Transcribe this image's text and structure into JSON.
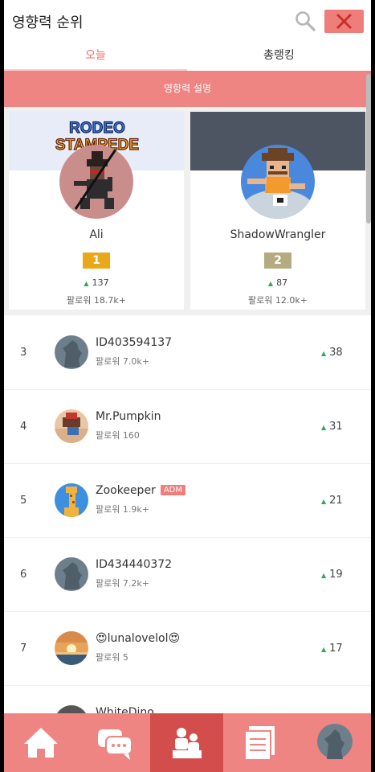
{
  "header": {
    "title": "영향력 순위"
  },
  "tabs": [
    {
      "label": "오늘",
      "active": true
    },
    {
      "label": "총랭킹",
      "active": false
    }
  ],
  "explain_label": "영향력 설명",
  "colors": {
    "accent": "#ef8583",
    "up": "#2fa84f",
    "gold": "#e8a81a",
    "silver": "#b4ab80"
  },
  "top": [
    {
      "rank": "1",
      "name": "Ali",
      "score": "137",
      "followers": "팔로워 18.7k+",
      "logo_text": "RODEO STAMPEDE"
    },
    {
      "rank": "2",
      "name": "ShadowWrangler",
      "score": "87",
      "followers": "팔로워 12.0k+"
    }
  ],
  "list": [
    {
      "rank": "3",
      "name": "ID403594137",
      "followers": "팔로워 7.0k+",
      "score": "38"
    },
    {
      "rank": "4",
      "name": "Mr.Pumpkin",
      "followers": "팔로워 160",
      "score": "31"
    },
    {
      "rank": "5",
      "name": "Zookeeper",
      "badge": "ADM",
      "followers": "팔로워 1.9k+",
      "score": "21"
    },
    {
      "rank": "6",
      "name": "ID434440372",
      "followers": "팔로워 7.2k+",
      "score": "19"
    },
    {
      "rank": "7",
      "name": "😍lunalovelol😍",
      "followers": "팔로워 5",
      "score": "17"
    },
    {
      "rank": "",
      "name": "WhiteDino",
      "followers": "",
      "score": ""
    }
  ],
  "nav": [
    {
      "icon": "home-icon"
    },
    {
      "icon": "chat-icon"
    },
    {
      "icon": "ranking-icon",
      "active": true
    },
    {
      "icon": "feed-icon"
    },
    {
      "icon": "profile-avatar"
    }
  ]
}
